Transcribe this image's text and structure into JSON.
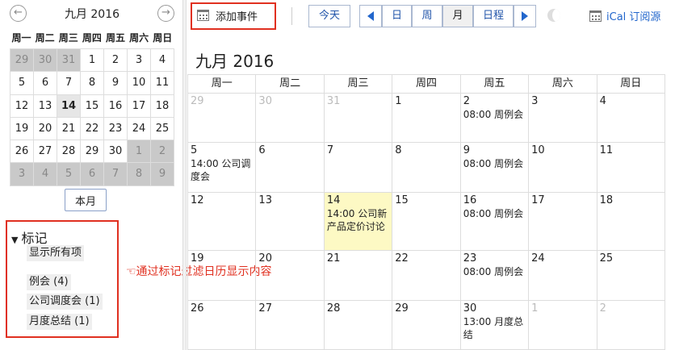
{
  "mini": {
    "title": "九月 2016",
    "prev_glyph": "←",
    "next_glyph": "→",
    "dow": [
      "周一",
      "周二",
      "周三",
      "周四",
      "周五",
      "周六",
      "周日"
    ],
    "weeks": [
      [
        {
          "d": "29",
          "other": true
        },
        {
          "d": "30",
          "other": true
        },
        {
          "d": "31",
          "other": true
        },
        {
          "d": "1"
        },
        {
          "d": "2"
        },
        {
          "d": "3"
        },
        {
          "d": "4"
        }
      ],
      [
        {
          "d": "5"
        },
        {
          "d": "6"
        },
        {
          "d": "7"
        },
        {
          "d": "8"
        },
        {
          "d": "9"
        },
        {
          "d": "10"
        },
        {
          "d": "11"
        }
      ],
      [
        {
          "d": "12"
        },
        {
          "d": "13"
        },
        {
          "d": "14",
          "today": true
        },
        {
          "d": "15"
        },
        {
          "d": "16"
        },
        {
          "d": "17"
        },
        {
          "d": "18"
        }
      ],
      [
        {
          "d": "19"
        },
        {
          "d": "20"
        },
        {
          "d": "21"
        },
        {
          "d": "22"
        },
        {
          "d": "23"
        },
        {
          "d": "24"
        },
        {
          "d": "25"
        }
      ],
      [
        {
          "d": "26"
        },
        {
          "d": "27"
        },
        {
          "d": "28"
        },
        {
          "d": "29"
        },
        {
          "d": "30"
        },
        {
          "d": "1",
          "other": true
        },
        {
          "d": "2",
          "other": true
        }
      ],
      [
        {
          "d": "3",
          "other": true
        },
        {
          "d": "4",
          "other": true
        },
        {
          "d": "5",
          "other": true
        },
        {
          "d": "6",
          "other": true
        },
        {
          "d": "7",
          "other": true
        },
        {
          "d": "8",
          "other": true
        },
        {
          "d": "9",
          "other": true
        }
      ]
    ],
    "this_month_label": "本月"
  },
  "tags": {
    "title": "标记",
    "toggle_glyph": "▼",
    "show_all": "显示所有项",
    "items": [
      "例会 (4)",
      "公司调度会 (1)",
      "月度总结 (1)"
    ]
  },
  "annotation": "☜通过标记过滤日历显示内容",
  "toolbar": {
    "add_event": "添加事件",
    "today": "今天",
    "views": [
      "日",
      "周",
      "月",
      "日程"
    ],
    "active_view": "月",
    "ical": "iCal 订阅源"
  },
  "calendar": {
    "title": "九月 2016",
    "dow": [
      "周一",
      "周二",
      "周三",
      "周四",
      "周五",
      "周六",
      "周日"
    ],
    "weeks": [
      [
        {
          "d": "29",
          "other": true
        },
        {
          "d": "30",
          "other": true
        },
        {
          "d": "31",
          "other": true
        },
        {
          "d": "1"
        },
        {
          "d": "2",
          "events": [
            "08:00 周例会"
          ]
        },
        {
          "d": "3"
        },
        {
          "d": "4"
        }
      ],
      [
        {
          "d": "5",
          "events": [
            "14:00 公司调度会"
          ]
        },
        {
          "d": "6"
        },
        {
          "d": "7"
        },
        {
          "d": "8"
        },
        {
          "d": "9",
          "events": [
            "08:00 周例会"
          ]
        },
        {
          "d": "10"
        },
        {
          "d": "11"
        }
      ],
      [
        {
          "d": "12"
        },
        {
          "d": "13"
        },
        {
          "d": "14",
          "today": true,
          "events": [
            "14:00 公司新产品定价讨论"
          ]
        },
        {
          "d": "15"
        },
        {
          "d": "16",
          "events": [
            "08:00 周例会"
          ]
        },
        {
          "d": "17"
        },
        {
          "d": "18"
        }
      ],
      [
        {
          "d": "19"
        },
        {
          "d": "20"
        },
        {
          "d": "21"
        },
        {
          "d": "22"
        },
        {
          "d": "23",
          "events": [
            "08:00 周例会"
          ]
        },
        {
          "d": "24"
        },
        {
          "d": "25"
        }
      ],
      [
        {
          "d": "26"
        },
        {
          "d": "27"
        },
        {
          "d": "28"
        },
        {
          "d": "29"
        },
        {
          "d": "30",
          "events": [
            "13:00 月度总结"
          ]
        },
        {
          "d": "1",
          "other": true
        },
        {
          "d": "2",
          "other": true
        }
      ]
    ]
  },
  "colors": {
    "accent": "#2266cc",
    "highlight": "#e03020",
    "today_bg": "#fdf9c4",
    "other_month_bg": "#c9c9c9"
  }
}
